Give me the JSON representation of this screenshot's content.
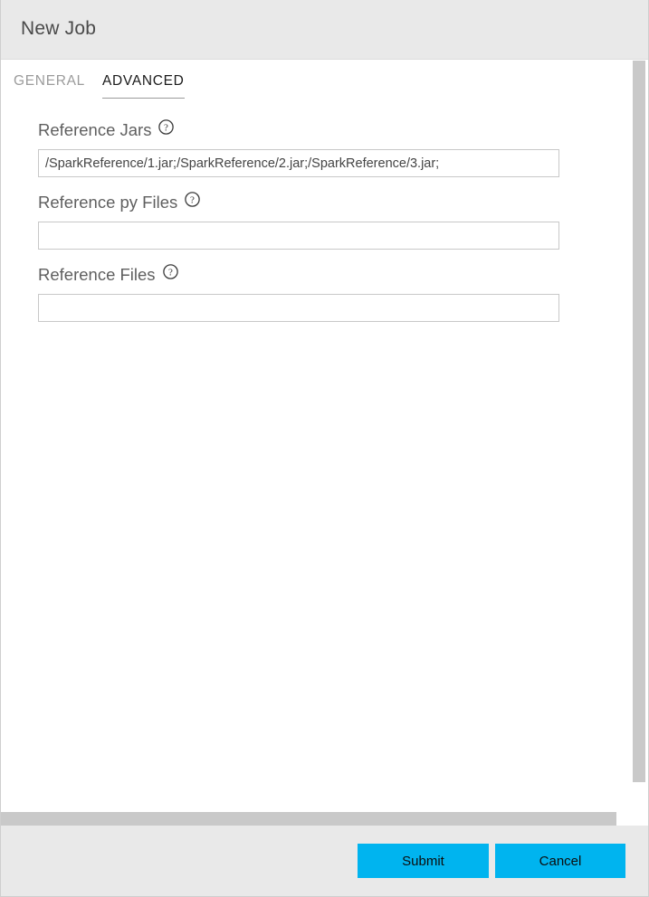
{
  "window": {
    "title": "New Job"
  },
  "tabs": [
    {
      "label": "GENERAL",
      "active": false
    },
    {
      "label": "ADVANCED",
      "active": true
    }
  ],
  "form": {
    "fields": [
      {
        "label": "Reference Jars",
        "help_icon": "question-circle-icon",
        "value": "/SparkReference/1.jar;/SparkReference/2.jar;/SparkReference/3.jar;",
        "placeholder": ""
      },
      {
        "label": "Reference py Files",
        "help_icon": "question-circle-icon",
        "value": "",
        "placeholder": ""
      },
      {
        "label": "Reference Files",
        "help_icon": "question-circle-icon",
        "value": "",
        "placeholder": ""
      }
    ]
  },
  "footer": {
    "submit_label": "Submit",
    "cancel_label": "Cancel"
  },
  "colors": {
    "accent": "#00b4ef",
    "titlebar_bg": "#e9e9e9",
    "footer_bg": "#e9e9e9",
    "scrollbar_thumb": "#c9c9c9",
    "tab_active_text": "#1a1a1a",
    "tab_inactive_text": "#9b9b9b",
    "label_text": "#5f5f5f",
    "input_border": "#c8c8c8"
  }
}
